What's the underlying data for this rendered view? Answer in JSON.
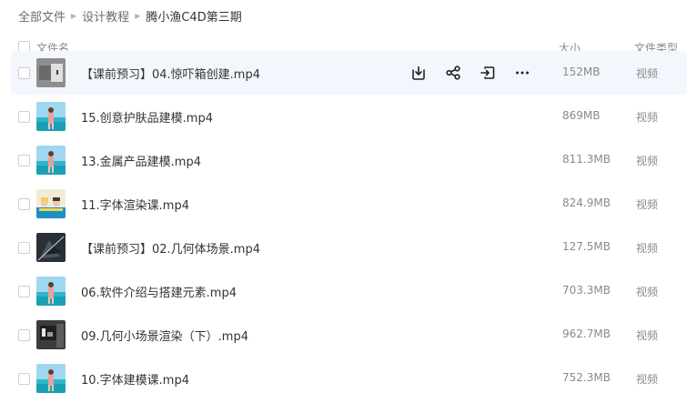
{
  "breadcrumb": [
    {
      "label": "全部文件",
      "current": false
    },
    {
      "label": "设计教程",
      "current": false
    },
    {
      "label": "腾小渔C4D第三期",
      "current": true
    }
  ],
  "columns": {
    "name": "文件名",
    "size": "大小",
    "type": "文件类型"
  },
  "colors": {
    "hover_row": "#f3f7fd",
    "text": "#333333",
    "muted": "#8a8a8a"
  },
  "row_actions": [
    {
      "name": "download-icon"
    },
    {
      "name": "share-icon"
    },
    {
      "name": "move-to-icon"
    },
    {
      "name": "more-icon"
    }
  ],
  "files": [
    {
      "name": "【课前预习】04.惊吓箱创建.mp4",
      "size": "152MB",
      "type": "视频",
      "thumb": "box",
      "hover": true
    },
    {
      "name": "15.创意护肤品建模.mp4",
      "size": "869MB",
      "type": "视频",
      "thumb": "beach",
      "hover": false
    },
    {
      "name": "13.金属产品建模.mp4",
      "size": "811.3MB",
      "type": "视频",
      "thumb": "beach",
      "hover": false
    },
    {
      "name": "11.字体渲染课.mp4",
      "size": "824.9MB",
      "type": "视频",
      "thumb": "people",
      "hover": false
    },
    {
      "name": "【课前预习】02.几何体场景.mp4",
      "size": "127.5MB",
      "type": "视频",
      "thumb": "dark",
      "hover": false
    },
    {
      "name": "06.软件介绍与搭建元素.mp4",
      "size": "703.3MB",
      "type": "视频",
      "thumb": "beach",
      "hover": false
    },
    {
      "name": "09.几何小场景渲染（下）.mp4",
      "size": "962.7MB",
      "type": "视频",
      "thumb": "scene",
      "hover": false
    },
    {
      "name": "10.字体建模课.mp4",
      "size": "752.3MB",
      "type": "视频",
      "thumb": "beach",
      "hover": false
    }
  ]
}
